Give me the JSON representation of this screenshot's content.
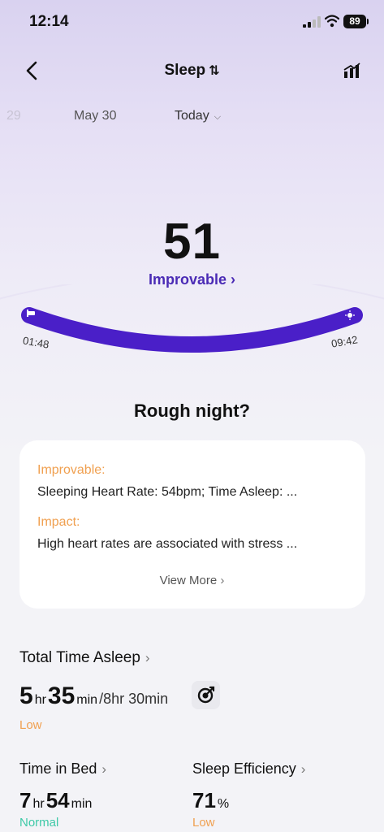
{
  "status_bar": {
    "time": "12:14",
    "battery": "89"
  },
  "header": {
    "title": "Sleep",
    "sort_glyph": "⇅"
  },
  "dates": {
    "previous": "29",
    "selected": "May 30",
    "today": "Today"
  },
  "score": {
    "value": "51",
    "label": "Improvable",
    "accent": "#4a2bb5"
  },
  "timeline": {
    "start": "01:48",
    "end": "09:42"
  },
  "insight": {
    "heading": "Rough night?",
    "improvable_label": "Improvable:",
    "improvable_text": "Sleeping Heart Rate: 54bpm; Time Asleep: ...",
    "impact_label": "Impact:",
    "impact_text": "High heart rates are associated with stress ...",
    "view_more": "View More"
  },
  "total_time_asleep": {
    "title": "Total Time Asleep",
    "hours": "5",
    "hr_unit": "hr",
    "minutes": "35",
    "min_unit": "min",
    "goal": "/8hr 30min",
    "status": "Low"
  },
  "time_in_bed": {
    "title": "Time in Bed",
    "hours": "7",
    "hr_unit": "hr",
    "minutes": "54",
    "min_unit": "min",
    "status": "Normal"
  },
  "sleep_efficiency": {
    "title": "Sleep Efficiency",
    "value": "71",
    "unit": "%",
    "status": "Low"
  },
  "colors": {
    "warning": "#f0a050",
    "normal": "#3ec9a7",
    "arc": "#4a1fc8"
  },
  "icons": [
    "back-arrow-icon",
    "sort-icon",
    "chart-icon",
    "chevron-down-icon",
    "bed-icon",
    "sun-icon",
    "chevron-right-icon",
    "target-icon"
  ]
}
